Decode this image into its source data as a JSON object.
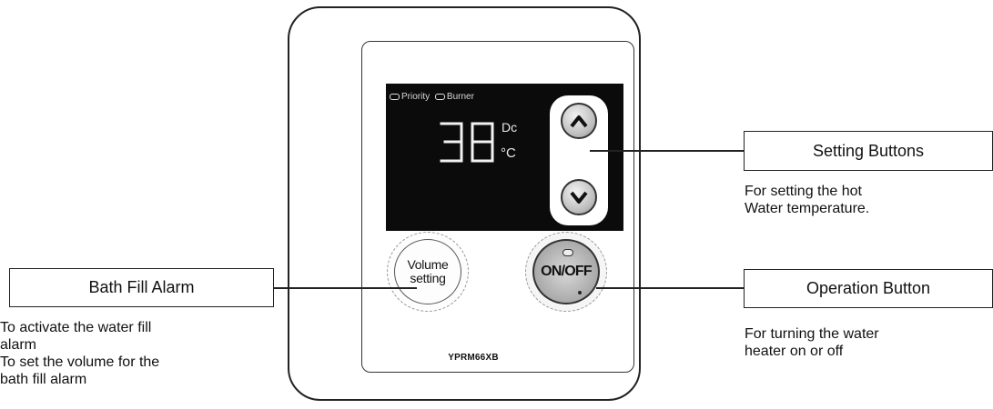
{
  "device": {
    "model": "YPRM66XB",
    "display": {
      "indicator_left": "Priority",
      "indicator_right": "Burner",
      "temperature": "38",
      "unit_top": "Dc",
      "unit_bottom": "°C"
    },
    "volume_button": {
      "line1": "Volume",
      "line2": "setting"
    },
    "onoff_button": {
      "label": "ON/OFF"
    }
  },
  "callouts": {
    "setting_buttons": {
      "title": "Setting Buttons",
      "desc_lines": [
        "For setting the hot",
        "Water temperature."
      ]
    },
    "operation_button": {
      "title": "Operation Button",
      "desc_lines": [
        "For turning the water",
        "heater on or off"
      ]
    },
    "bath_fill_alarm": {
      "title": "Bath Fill Alarm",
      "desc_lines": [
        "To activate the water fill",
        "alarm",
        "To set the volume for the",
        "bath fill alarm"
      ]
    }
  }
}
